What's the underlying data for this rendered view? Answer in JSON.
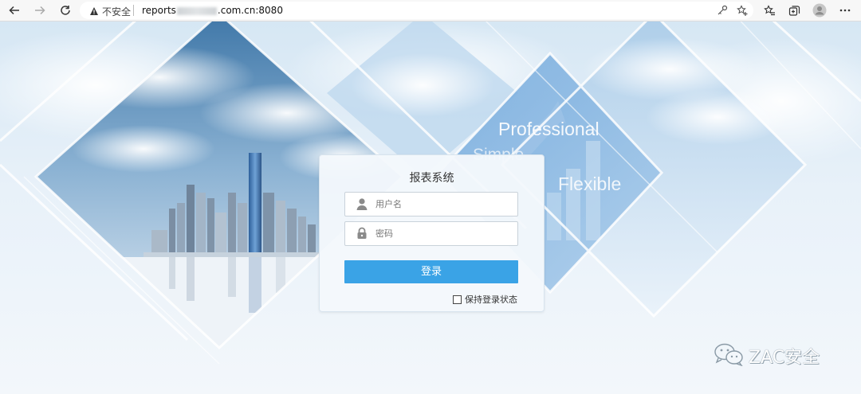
{
  "browser": {
    "insecure_label": "不安全",
    "url_prefix": "reports",
    "url_suffix": ".com.cn:8080"
  },
  "hero": {
    "word1": "Professional",
    "word2": "Simple",
    "word3": "Flexible"
  },
  "login": {
    "title": "报表系统",
    "username_placeholder": "用户名",
    "password_placeholder": "密码",
    "submit_label": "登录",
    "remember_label": "保持登录状态"
  },
  "watermark": {
    "text": "ZAC安全"
  },
  "colors": {
    "accent": "#3aa3e6",
    "page_bg": "#e8f1f9"
  }
}
